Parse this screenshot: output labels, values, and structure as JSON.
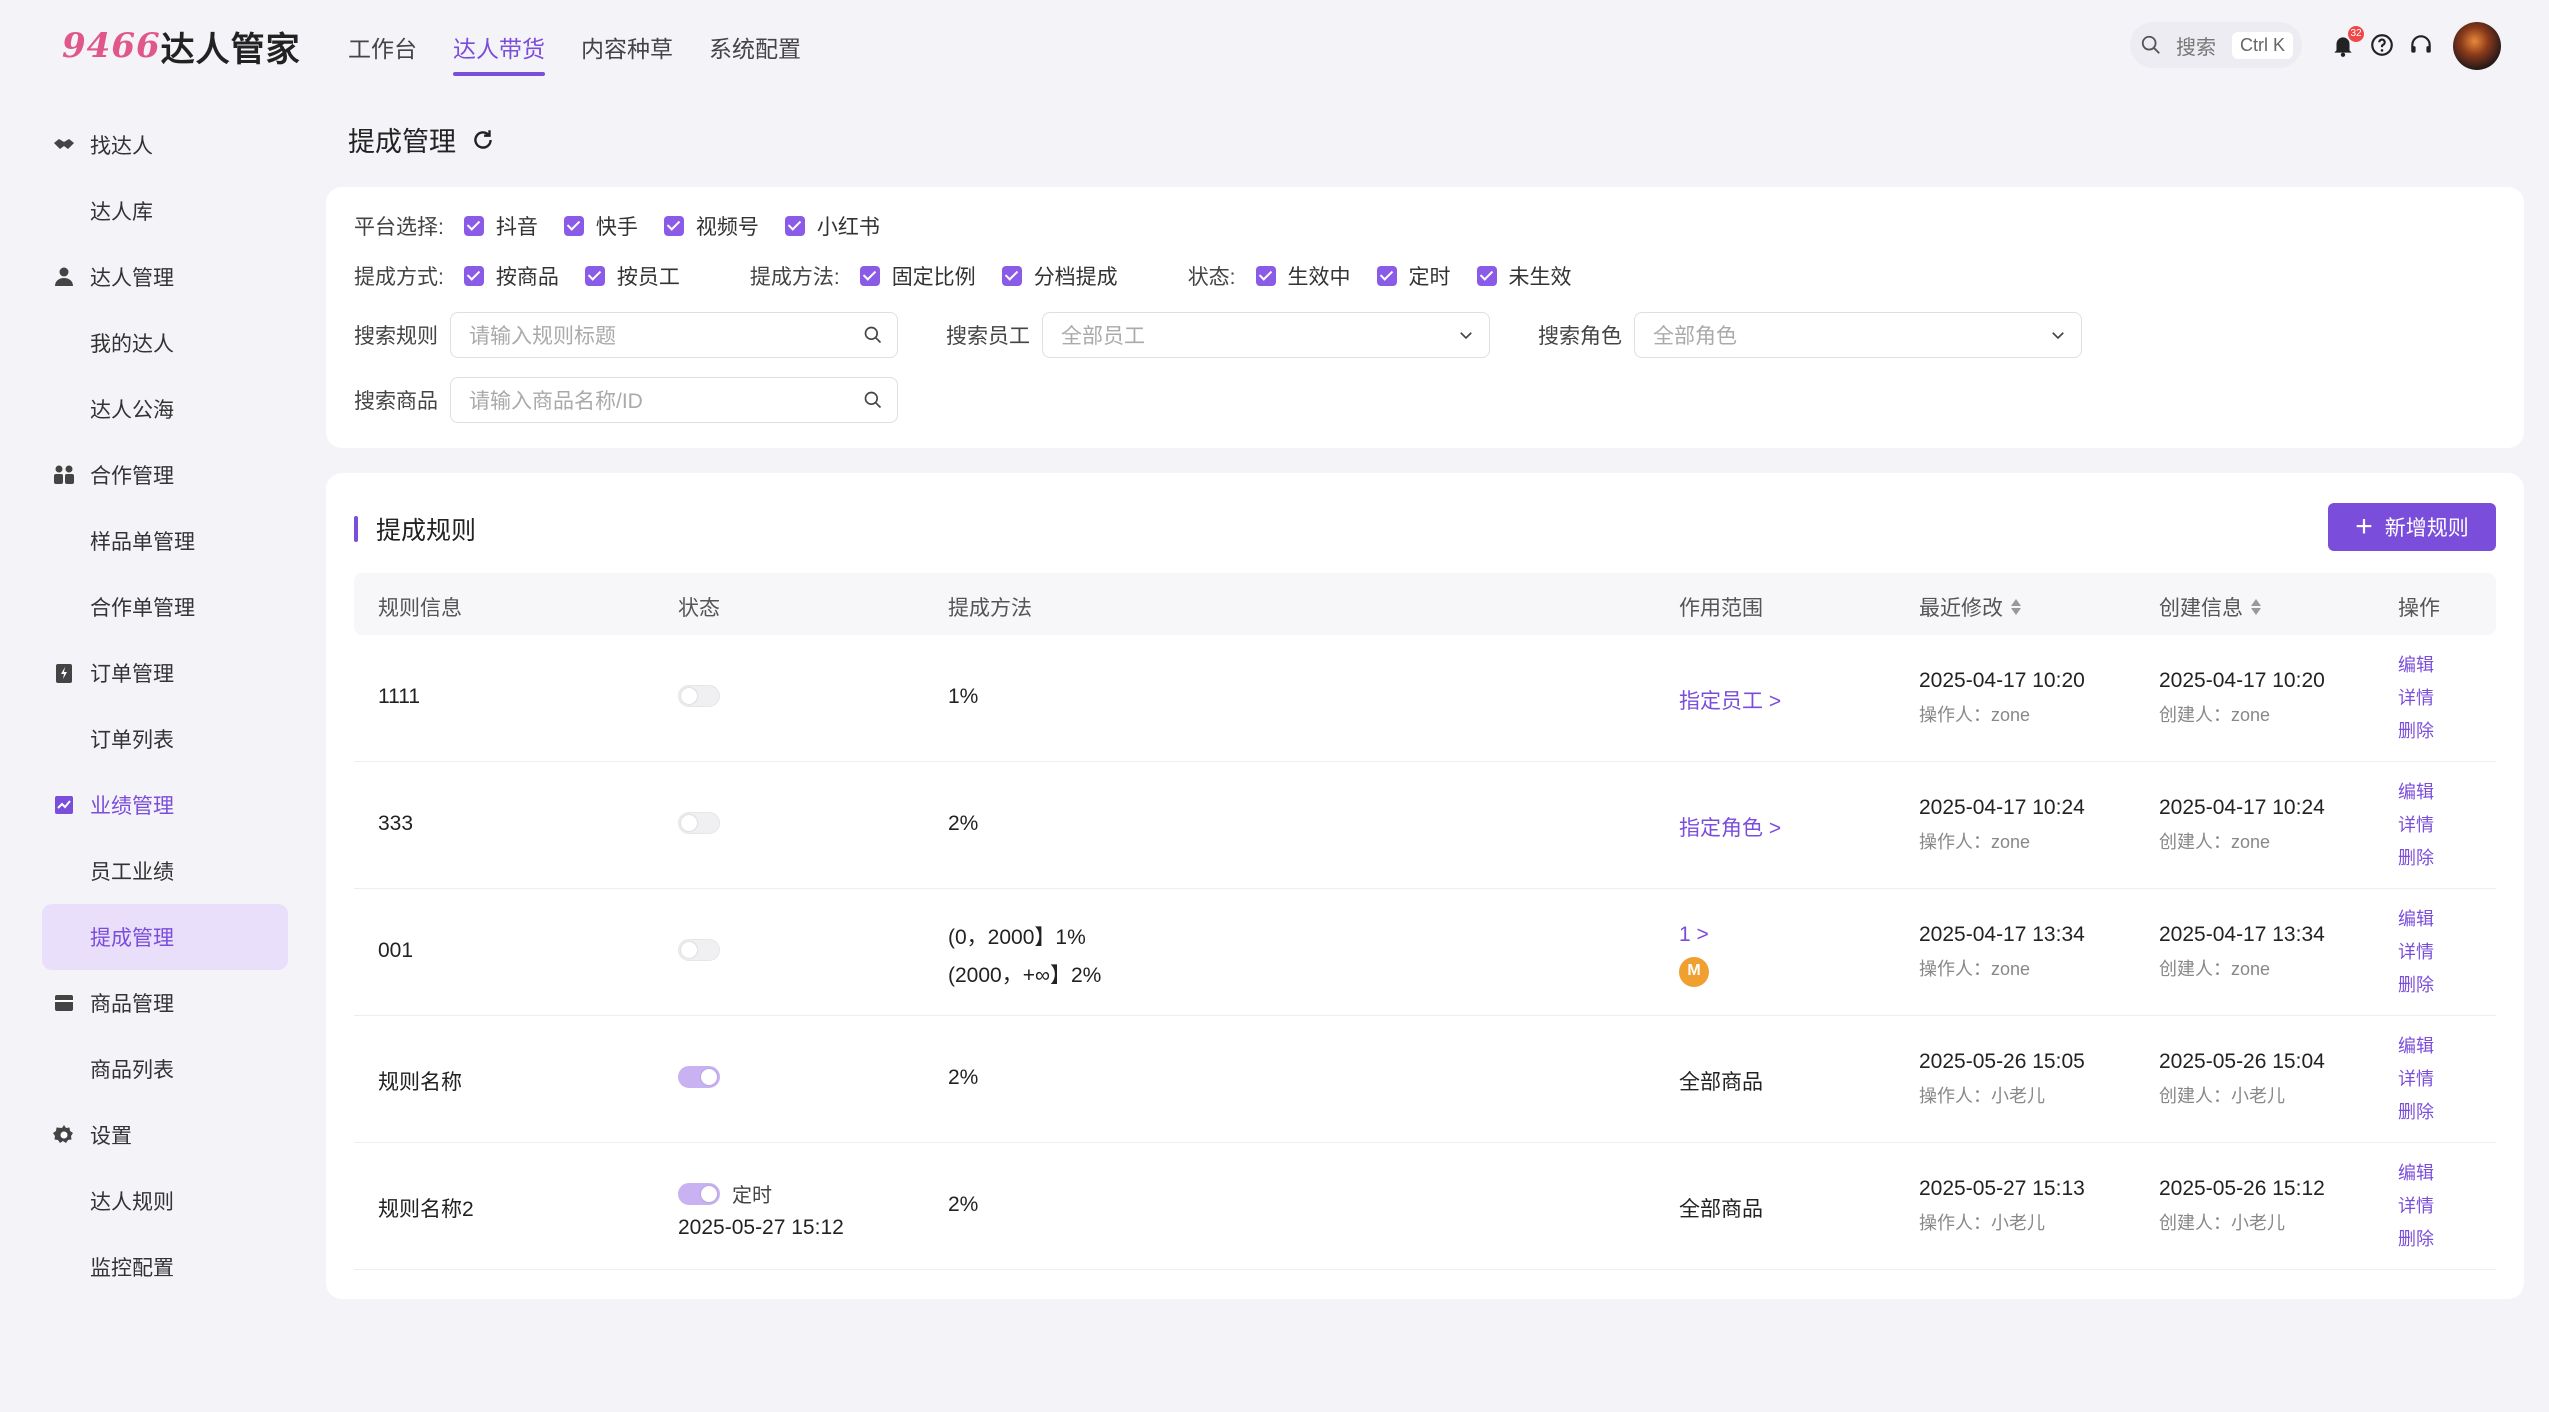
{
  "logo": {
    "num": "9466",
    "name": "达人管家"
  },
  "nav": [
    "工作台",
    "达人带货",
    "内容种草",
    "系统配置"
  ],
  "header": {
    "search_label": "搜索",
    "shortcut": "Ctrl K",
    "notification_count": "32"
  },
  "sidebar": {
    "groups": [
      {
        "label": "找达人",
        "icon": "handshake-icon",
        "items": [
          "达人库"
        ]
      },
      {
        "label": "达人管理",
        "icon": "user-icon",
        "items": [
          "我的达人",
          "达人公海"
        ]
      },
      {
        "label": "合作管理",
        "icon": "team-icon",
        "items": [
          "样品单管理",
          "合作单管理"
        ]
      },
      {
        "label": "订单管理",
        "icon": "order-icon",
        "items": [
          "订单列表"
        ]
      },
      {
        "label": "业绩管理",
        "icon": "chart-icon",
        "items": [
          "员工业绩",
          "提成管理"
        ]
      },
      {
        "label": "商品管理",
        "icon": "box-icon",
        "items": [
          "商品列表"
        ]
      },
      {
        "label": "设置",
        "icon": "gear-icon",
        "items": [
          "达人规则",
          "监控配置"
        ]
      }
    ],
    "active_item": "提成管理"
  },
  "page": {
    "title": "提成管理"
  },
  "filters": {
    "platform_label": "平台选择:",
    "platforms": [
      "抖音",
      "快手",
      "视频号",
      "小红书"
    ],
    "mode_label": "提成方式:",
    "modes": [
      "按商品",
      "按员工"
    ],
    "method_label": "提成方法:",
    "methods": [
      "固定比例",
      "分档提成"
    ],
    "status_label": "状态:",
    "statuses": [
      "生效中",
      "定时",
      "未生效"
    ],
    "search_rule_label": "搜索规则",
    "search_rule_placeholder": "请输入规则标题",
    "search_staff_label": "搜索员工",
    "search_staff_value": "全部员工",
    "search_role_label": "搜索角色",
    "search_role_value": "全部角色",
    "search_product_label": "搜索商品",
    "search_product_placeholder": "请输入商品名称/ID"
  },
  "table": {
    "title": "提成规则",
    "add_button": "新增规则",
    "columns": [
      "规则信息",
      "状态",
      "提成方法",
      "作用范围",
      "最近修改",
      "创建信息",
      "操作"
    ],
    "ops": [
      "编辑",
      "详情",
      "删除"
    ],
    "rows": [
      {
        "name": "1111",
        "toggle_on": false,
        "status_text": "",
        "status_time": "",
        "method": [
          "1%"
        ],
        "scope": "指定员工 >",
        "scope_link": true,
        "modified": "2025-04-17 10:20",
        "modified_by": "操作人：zone",
        "created": "2025-04-17 10:20",
        "created_by": "创建人：zone"
      },
      {
        "name": "333",
        "toggle_on": false,
        "status_text": "",
        "status_time": "",
        "method": [
          "2%"
        ],
        "scope": "指定角色 >",
        "scope_link": true,
        "modified": "2025-04-17 10:24",
        "modified_by": "操作人：zone",
        "created": "2025-04-17 10:24",
        "created_by": "创建人：zone"
      },
      {
        "name": "001",
        "toggle_on": false,
        "status_text": "",
        "status_time": "",
        "method": [
          "(0，2000】1%",
          "(2000，+∞】2%"
        ],
        "scope": "1 >",
        "scope_link": true,
        "scope_brand": true,
        "modified": "2025-04-17 13:34",
        "modified_by": "操作人：zone",
        "created": "2025-04-17 13:34",
        "created_by": "创建人：zone"
      },
      {
        "name": "规则名称",
        "toggle_on": true,
        "status_text": "",
        "status_time": "",
        "method": [
          "2%"
        ],
        "scope": "全部商品",
        "scope_link": false,
        "modified": "2025-05-26 15:05",
        "modified_by": "操作人：小老儿",
        "created": "2025-05-26 15:04",
        "created_by": "创建人：小老儿"
      },
      {
        "name": "规则名称2",
        "toggle_on": true,
        "status_text": "定时",
        "status_time": "2025-05-27 15:12",
        "method": [
          "2%"
        ],
        "scope": "全部商品",
        "scope_link": false,
        "modified": "2025-05-27 15:13",
        "modified_by": "操作人：小老儿",
        "created": "2025-05-26 15:12",
        "created_by": "创建人：小老儿"
      }
    ]
  },
  "colors": {
    "accent": "#7b4ddb",
    "accent_light": "#e9dffb",
    "background": "#f3f3f8"
  }
}
